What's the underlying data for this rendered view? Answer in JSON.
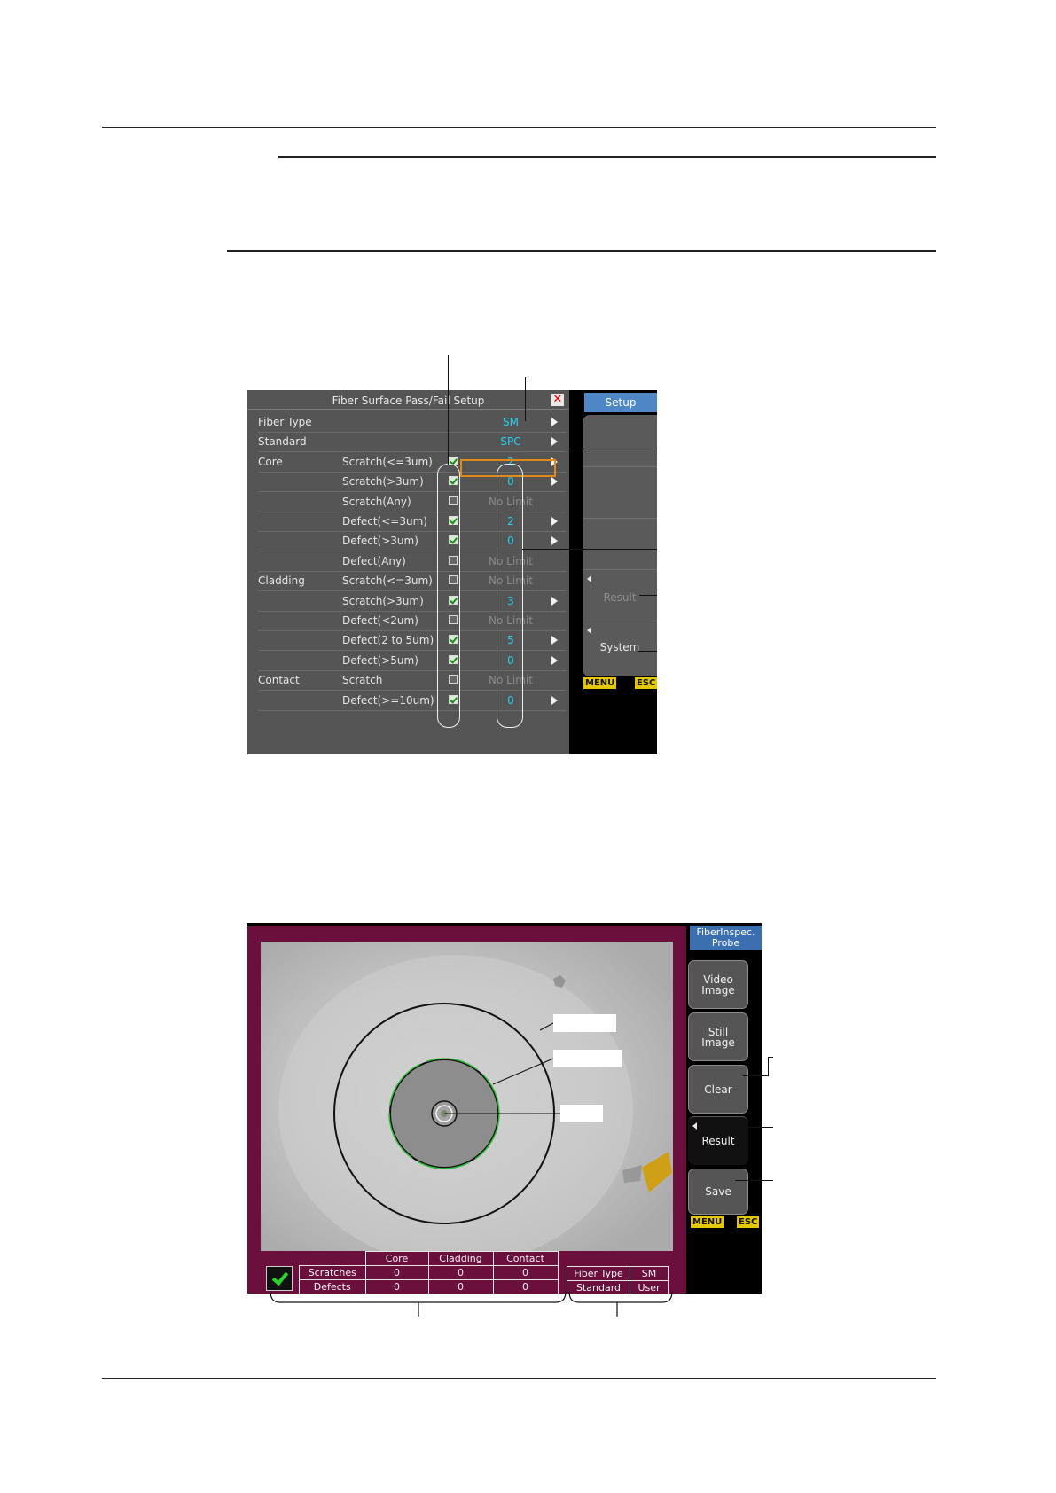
{
  "setup_screen": {
    "title": "Fiber Surface Pass/Fail Setup",
    "close_icon": "close-icon",
    "rows": [
      {
        "section": "Fiber Type",
        "item": "",
        "checked": null,
        "value": "SM",
        "dim": false,
        "arrow": true
      },
      {
        "section": "Standard",
        "item": "",
        "checked": null,
        "value": "SPC",
        "dim": false,
        "arrow": true
      },
      {
        "section": "Core",
        "item": "Scratch(<=3um)",
        "checked": true,
        "value": "2",
        "dim": false,
        "arrow": true
      },
      {
        "section": "",
        "item": "Scratch(>3um)",
        "checked": true,
        "value": "0",
        "dim": false,
        "arrow": true
      },
      {
        "section": "",
        "item": "Scratch(Any)",
        "checked": false,
        "value": "No Limit",
        "dim": true,
        "arrow": false
      },
      {
        "section": "",
        "item": "Defect(<=3um)",
        "checked": true,
        "value": "2",
        "dim": false,
        "arrow": true
      },
      {
        "section": "",
        "item": "Defect(>3um)",
        "checked": true,
        "value": "0",
        "dim": false,
        "arrow": true
      },
      {
        "section": "",
        "item": "Defect(Any)",
        "checked": false,
        "value": "No Limit",
        "dim": true,
        "arrow": false
      },
      {
        "section": "Cladding",
        "item": "Scratch(<=3um)",
        "checked": false,
        "value": "No Limit",
        "dim": true,
        "arrow": false
      },
      {
        "section": "",
        "item": "Scratch(>3um)",
        "checked": true,
        "value": "3",
        "dim": false,
        "arrow": true
      },
      {
        "section": "",
        "item": "Defect(<2um)",
        "checked": false,
        "value": "No Limit",
        "dim": true,
        "arrow": false
      },
      {
        "section": "",
        "item": "Defect(2 to 5um)",
        "checked": true,
        "value": "5",
        "dim": false,
        "arrow": true
      },
      {
        "section": "",
        "item": "Defect(>5um)",
        "checked": true,
        "value": "0",
        "dim": false,
        "arrow": true
      },
      {
        "section": "Contact",
        "item": "Scratch",
        "checked": false,
        "value": "No Limit",
        "dim": true,
        "arrow": false
      },
      {
        "section": "",
        "item": "Defect(>=10um)",
        "checked": true,
        "value": "0",
        "dim": false,
        "arrow": true
      }
    ],
    "side_tab": "Setup",
    "result_label": "Result",
    "system_label": "System",
    "menu_key": "MENU",
    "esc_key": "ESC"
  },
  "probe_screen": {
    "side_tab": "FiberInspec.\nProbe",
    "buttons": {
      "video": "Video\nImage",
      "still": "Still\nImage",
      "clear": "Clear",
      "result": "Result",
      "save": "Save"
    },
    "menu_key": "MENU",
    "esc_key": "ESC",
    "result_table": {
      "headers": [
        "Core",
        "Cladding",
        "Contact"
      ],
      "rows": [
        {
          "label": "Scratches",
          "values": [
            "0",
            "0",
            "0"
          ]
        },
        {
          "label": "Defects",
          "values": [
            "0",
            "0",
            "0"
          ]
        }
      ]
    },
    "fiber_table": {
      "fiber_type_label": "Fiber Type",
      "fiber_type_value": "SM",
      "standard_label": "Standard",
      "standard_value": "User"
    },
    "pass_icon": "check-icon"
  },
  "colors": {
    "dialog_bg": "#555555",
    "value_cyan": "#25d2f0",
    "selection_orange": "#e08a18",
    "tab_blue": "#4f86c6",
    "frame_maroon": "#6b0f3c",
    "key_yellow": "#e6c800"
  }
}
